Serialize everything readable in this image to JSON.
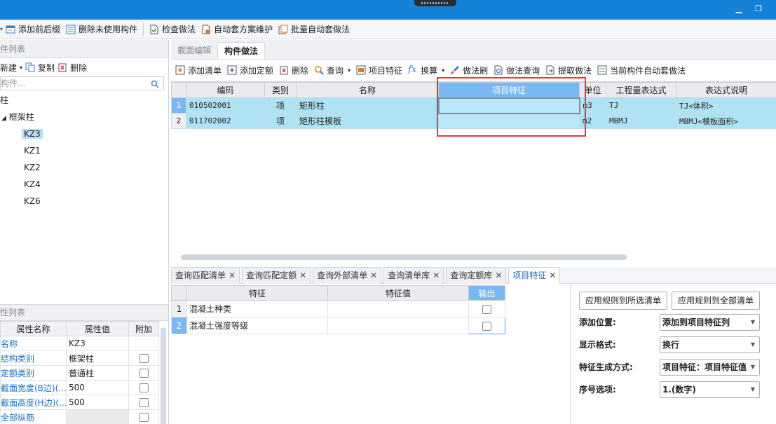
{
  "toolbar": {
    "add_prefix_suffix": "添加前后缀",
    "delete_unused": "删除未使用构件",
    "check_method": "检查做法",
    "auto_scheme": "自动套方案维护",
    "batch_auto": "批量自动套做法"
  },
  "left": {
    "list_header": "件列表",
    "new_label": "新建",
    "copy_label": "复制",
    "delete_label": "删除",
    "search_placeholder": "构件...",
    "tree_root": "柱",
    "tree_group": "框架柱",
    "tree_items": [
      "KZ3",
      "KZ1",
      "KZ2",
      "KZ4",
      "KZ6"
    ],
    "selected_item": "KZ3"
  },
  "props": {
    "header": "性列表",
    "columns": [
      "属性名称",
      "属性值",
      "附加"
    ],
    "rows": [
      {
        "name": "名称",
        "value": "KZ3"
      },
      {
        "name": "结构类别",
        "value": "框架柱"
      },
      {
        "name": "定额类别",
        "value": "普通柱"
      },
      {
        "name": "截面宽度(B边)(...",
        "value": "500"
      },
      {
        "name": "截面高度(H边)(...",
        "value": "500"
      },
      {
        "name": "全部纵筋",
        "value": ""
      }
    ]
  },
  "top_tabs": {
    "section_edit": "截面编辑",
    "component_method": "构件做法"
  },
  "tools2": {
    "add_list": "添加清单",
    "add_quota": "添加定额",
    "delete": "删除",
    "query": "查询",
    "project_feature": "项目特征",
    "convert": "换算",
    "method_brush": "做法刷",
    "method_query": "做法查询",
    "extract_method": "提取做法",
    "current_auto": "当前构件自动套做法"
  },
  "method_table": {
    "columns": [
      "编码",
      "类别",
      "名称",
      "项目特征",
      "单位",
      "工程量表达式",
      "表达式说明"
    ],
    "rows": [
      {
        "num": "1",
        "code": "010502001",
        "type": "项",
        "name": "矩形柱",
        "feature": "",
        "unit": "m3",
        "expr": "TJ",
        "desc": "TJ<体积>"
      },
      {
        "num": "2",
        "code": "011702002",
        "type": "项",
        "name": "矩形柱模板",
        "feature": "",
        "unit": "m2",
        "expr": "MBMJ",
        "desc": "MBMJ<模板面积>"
      }
    ]
  },
  "bottom_tabs": [
    "查询匹配清单",
    "查询匹配定额",
    "查询外部清单",
    "查询清单库",
    "查询定额库",
    "项目特征"
  ],
  "active_bottom_tab": "项目特征",
  "feature_table": {
    "columns": [
      "特征",
      "特征值",
      "输出"
    ],
    "rows": [
      {
        "num": "1",
        "feature": "混凝土种类",
        "value": "",
        "output": false
      },
      {
        "num": "2",
        "feature": "混凝土强度等级",
        "value": "",
        "output": false
      }
    ]
  },
  "rules": {
    "apply_selected": "应用规则到所选清单",
    "apply_all": "应用规则到全部清单",
    "add_position_label": "添加位置:",
    "add_position_value": "添加到项目特征列",
    "display_format_label": "显示格式:",
    "display_format_value": "换行",
    "gen_mode_label": "特征生成方式:",
    "gen_mode_value": "项目特征：项目特征值",
    "serial_label": "序号选项:",
    "serial_value": "1.(数字)"
  },
  "colors": {
    "title_bar": "#1582d8",
    "row_highlight": "#aee3f3",
    "header_highlight": "#79b8f2",
    "annotation_box": "#e23a3a"
  }
}
